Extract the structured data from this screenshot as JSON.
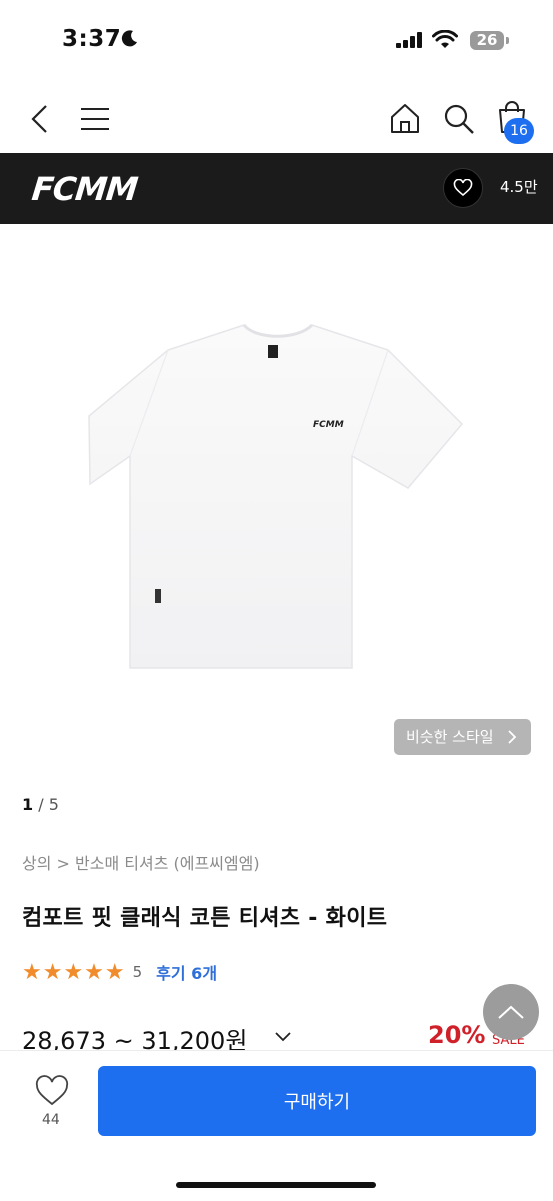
{
  "status_bar": {
    "time": "3:37",
    "battery": "26",
    "icons": [
      "moon-icon",
      "signal-icon",
      "wifi-icon",
      "battery-icon"
    ]
  },
  "nav": {
    "icons": [
      "back-icon",
      "menu-icon",
      "home-icon",
      "search-icon",
      "cart-icon"
    ],
    "cart_count": "16"
  },
  "brand": {
    "name": "FCMM",
    "likes": "4.5만"
  },
  "gallery": {
    "similar_style_label": "비슷한 스타일",
    "current": "1",
    "total": "/ 5"
  },
  "product": {
    "breadcrumb": "상의 > 반소매 티셔츠 (에프씨엠엠)",
    "title": "컴포트 핏 클래식 코튼 티셔츠 - 화이트",
    "stars": "★★★★★",
    "rating": "5",
    "reviews": "후기 6개",
    "price": "28,673 ~ 31,200원",
    "discount": "20%",
    "sale_label": "SALE"
  },
  "bottom_bar": {
    "wish_count": "44",
    "buy_label": "구매하기"
  },
  "colors": {
    "accent": "#1e6ff0",
    "brand_bar": "#1b1b1b",
    "star": "#f08c2b",
    "discount": "#d0202a",
    "review_link": "#2f6fd8"
  }
}
